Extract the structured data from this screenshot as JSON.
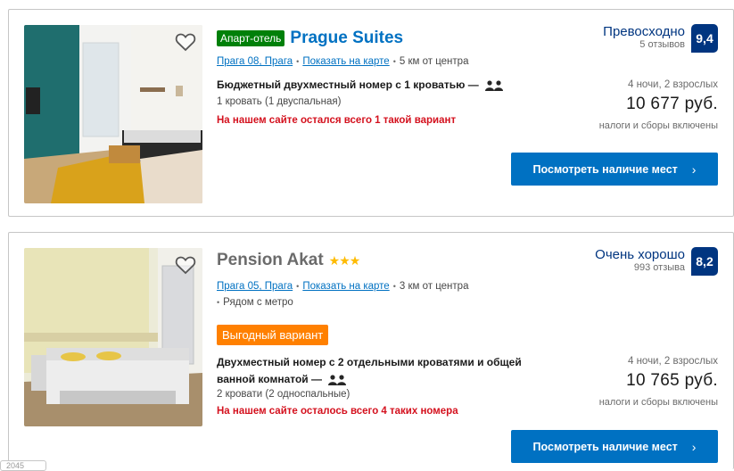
{
  "listings": [
    {
      "badge": "Апарт-отель",
      "name": "Prague Suites",
      "location_link": "Прага 08, Прага",
      "map_link": "Показать на карте",
      "distance": "5 км от центра",
      "room_title": "Бюджетный двухместный номер с 1 кроватью",
      "room_dash": "—",
      "bed_info": "1 кровать (1 двуспальная)",
      "scarcity": "На нашем сайте остался всего 1 такой вариант",
      "score_word": "Превосходно",
      "reviews": "5 отзывов",
      "score": "9,4",
      "stay": "4 ночи, 2 взрослых",
      "price": "10 677 руб.",
      "taxes": "налоги и сборы включены",
      "cta": "Посмотреть наличие мест",
      "cta_chevron": "›"
    },
    {
      "name": "Pension Akat",
      "stars": "★★★",
      "location_link": "Прага 05, Прага",
      "map_link": "Показать на карте",
      "distance": "3 км от центра",
      "metro": "Рядом с метро",
      "deal_badge": "Выгодный вариант",
      "room_title": "Двухместный номер с 2 отдельными кроватями и общей ванной комнатой",
      "room_dash": "—",
      "bed_info": "2 кровати (2 односпальные)",
      "scarcity": "На нашем сайте осталось всего 4 таких номера",
      "score_word": "Очень хорошо",
      "reviews": "993 отзыва",
      "score": "8,2",
      "stay": "4 ночи, 2 взрослых",
      "price": "10 765 руб.",
      "taxes": "налоги и сборы включены",
      "cta": "Посмотреть наличие мест",
      "cta_chevron": "›"
    }
  ],
  "footer_stub": "2045",
  "colors": {
    "brand_blue": "#0071c2",
    "navy": "#003580",
    "green_badge": "#008009",
    "deal_orange": "#ff8000",
    "alert_red": "#d4111e",
    "star_yellow": "#febb02"
  },
  "icons": [
    "heart-icon",
    "persons-icon",
    "chevron-right-icon",
    "star-icon"
  ]
}
